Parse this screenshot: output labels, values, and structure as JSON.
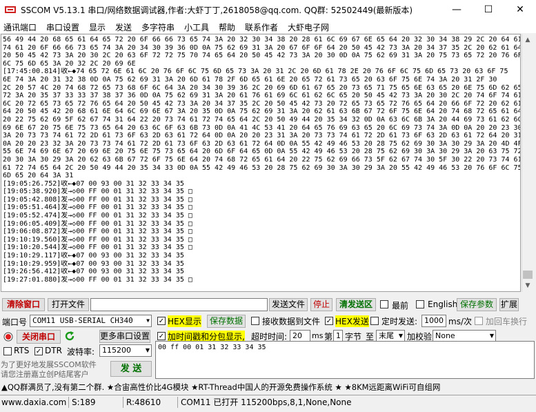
{
  "window": {
    "title": "SSCOM V5.13.1 串口/网络数据调试器,作者:大虾丁丁,2618058@qq.com. QQ群: 52502449(最新版本)",
    "minimize_glyph": "—",
    "maximize_glyph": "☐",
    "close_glyph": "✕"
  },
  "menu": [
    "通讯端口",
    "串口设置",
    "显示",
    "发送",
    "多字符串",
    "小工具",
    "帮助",
    "联系作者",
    "大虾电子网"
  ],
  "receive_lines": [
    "56 49 44 20 68 65 61 64 65 72 20 6F 66 66 73 65 74 3A 20 32 30 34 38 20 28 61 6C 69 67 6E 65 64 20 32 30 34 38 29 2C 20 64 61",
    "74 61 20 6F 66 66 73 65 74 3A 20 34 30 39 36 0D 0A 75 62 69 31 3A 20 67 6F 6F 64 20 50 45 42 73 3A 20 34 37 35 2C 20 62 61 64",
    "20 50 45 42 73 3A 20 30 2C 20 63 6F 72 72 75 70 74 65 64 20 50 45 42 73 3A 20 30 0D 0A 75 62 69 31 3A 20 75 73 65 72 20 76 6F",
    "6C 75 6D 65 3A 20 32 2C 20 69 6E",
    "[17:45:00.814]收←◆74 65 72 6E 61 6C 20 76 6F 6C 75 6D 65 73 3A 20 31 2C 20 6D 61 78 2E 20 76 6F 6C 75 6D 65 73 20 63 6F 75",
    "6E 74 3A 20 31 32 38 0D 0A 75 62 69 31 3A 20 6D 61 78 2F 6D 65 61 6E 20 65 72 61 73 65 20 63 6F 75 6E 74 3A 20 31 2F 30",
    "2C 20 57 4C 20 74 68 72 65 73 68 6F 6C 64 3A 20 34 30 39 36 2C 20 69 6D 61 67 65 20 73 65 71 75 65 6E 63 65 20 6E 75 6D 62 65",
    "72 3A 20 35 37 33 33 37 38 37 36 0D 0A 75 62 69 31 3A 20 61 76 61 69 6C 61 62 6C 65 20 50 45 42 73 3A 20 30 2C 20 74 6F 74 61",
    "6C 20 72 65 73 65 72 76 65 64 20 50 45 42 73 3A 20 34 37 35 2C 20 50 45 42 73 20 72 65 73 65 72 76 65 64 20 66 6F 72 20 62 61",
    "64 20 50 45 42 20 68 61 6E 64 6C 69 6E 67 3A 20 35 0D 0A 75 62 69 31 3A 20 62 61 63 6B 67 72 6F 75 6E 64 20 74 68 72 65 61 64",
    "20 22 75 62 69 5F 62 67 74 31 64 22 20 73 74 61 72 74 65 64 2C 20 50 49 44 20 35 34 32 0D 0A 63 6C 6B 3A 20 44 69 73 61 62 6C",
    "69 6E 67 20 75 6E 75 73 65 64 20 63 6C 6F 63 6B 73 0D 0A 41 4C 53 41 20 64 65 76 69 63 65 20 6C 69 73 74 3A 0D 0A 20 20 23 30",
    "3A 20 73 73 74 61 72 2D 61 73 6F 63 2D 63 61 72 64 0D 0A 20 20 23 31 3A 20 73 73 74 61 72 2D 61 73 6F 63 2D 63 61 72 64 20 31",
    "0A 20 20 23 32 3A 20 73 73 74 61 72 2D 61 73 6F 63 2D 63 61 72 64 0D 0A 55 42 49 46 53 20 28 75 62 69 30 3A 30 29 3A 20 4D 4F",
    "55 6E 74 69 6E 67 20 69 6E 20 75 6E 75 73 65 64 20 6D 6F 64 65 0D 0A 55 42 49 46 53 20 28 75 62 69 30 3A 30 29 3A 20 63 75 72",
    "20 30 3A 30 29 3A 20 62 63 6B 67 72 6F 75 6E 64 20 74 68 72 65 61 64 20 22 75 62 69 66 73 5F 62 67 74 30 5F 30 22 20 73 74 61",
    "61 72 74 65 64 2C 20 50 49 44 20 35 34 33 0D 0A 55 42 49 46 53 20 28 75 62 69 30 3A 30 29 3A 20 55 42 49 46 53 20 76 6F 6C 75",
    "6D 65 20 64 3A 31",
    "[19:05:26.752]收←◆07 00 93 00 31 32 33 34 35",
    "[19:05:38.920]发→◇00 FF 00 01 31 32 33 34 35 □",
    "[19:05:42.808]发→◇00 FF 00 01 31 32 33 34 35 □",
    "[19:05:51.464]发→◇00 FF 00 01 31 32 33 34 35 □",
    "[19:05:52.474]发→◇00 FF 00 01 31 32 33 34 35 □",
    "[19:06:05.409]发→◇00 FF 00 01 31 32 33 34 35 □",
    "[19:06:08.872]发→◇00 FF 00 01 31 32 33 34 35 □",
    "[19:10:19.560]发→◇00 FF 00 01 31 32 33 34 35 □",
    "[19:10:20.544]发→◇00 FF 00 01 31 32 33 34 35 □",
    "[19:10:29.117]收←◆07 00 93 00 31 32 33 34 35",
    "[19:10:29.959]收←◆07 00 93 00 31 32 33 34 35",
    "[19:26:56.412]收←◆07 00 93 00 31 32 33 34 35",
    "[19:27:01.880]发→◇00 FF 00 01 31 32 33 34 35 □"
  ],
  "toolbar1": {
    "clear_window": "清除窗口",
    "open_file": "打开文件",
    "send_file": "发送文件",
    "stop": "停止",
    "clear_send": "清发送区",
    "topmost": "最前",
    "english": "English",
    "save_params": "保存参数",
    "expand": "扩展"
  },
  "port": {
    "port_label": "端口号",
    "port_value": "COM11 USB-SERIAL CH340",
    "hex_display": "HEX显示",
    "save_data": "保存数据",
    "recv_to_file": "接收数据到文件",
    "hex_send": "HEX发送",
    "timed_send": "定时发送:",
    "interval": "1000",
    "interval_unit": "ms/次",
    "add_crlf": "加回车换行",
    "close_port": "关闭串口",
    "more_settings": "更多串口设置",
    "timestamp": "加时间戳和分包显示,",
    "timeout_label": "超时时间:",
    "timeout_value": "20",
    "ms": "ms",
    "nth_label": "第",
    "nth_value": "1",
    "byte_label": "字节",
    "to_label": "至",
    "to_value": "末尾",
    "checksum_label": "加校验",
    "checksum_value": "None",
    "rts": "RTS",
    "dtr": "DTR",
    "baud_label": "波特率:",
    "baud_value": "115200",
    "send_input": "00 ff 00 01 31 32 33 34 35",
    "send_button": "发  送",
    "promo_line1": "为了更好地发展SSCOM软件",
    "promo_line2": "请您注册嘉立创P结尾客户"
  },
  "ticker": "▲QQ群满员了,没有第二个群. ★合宙高性价比4G模块 ★RT-Thread中国人的开源免费操作系统 ★ ★8KM远距离WiFi可自组网",
  "status": {
    "site": "www.daxia.com",
    "sent": "S:189",
    "received": "R:48610",
    "port_state": "COM11 已打开  115200bps,8,1,None,None"
  }
}
